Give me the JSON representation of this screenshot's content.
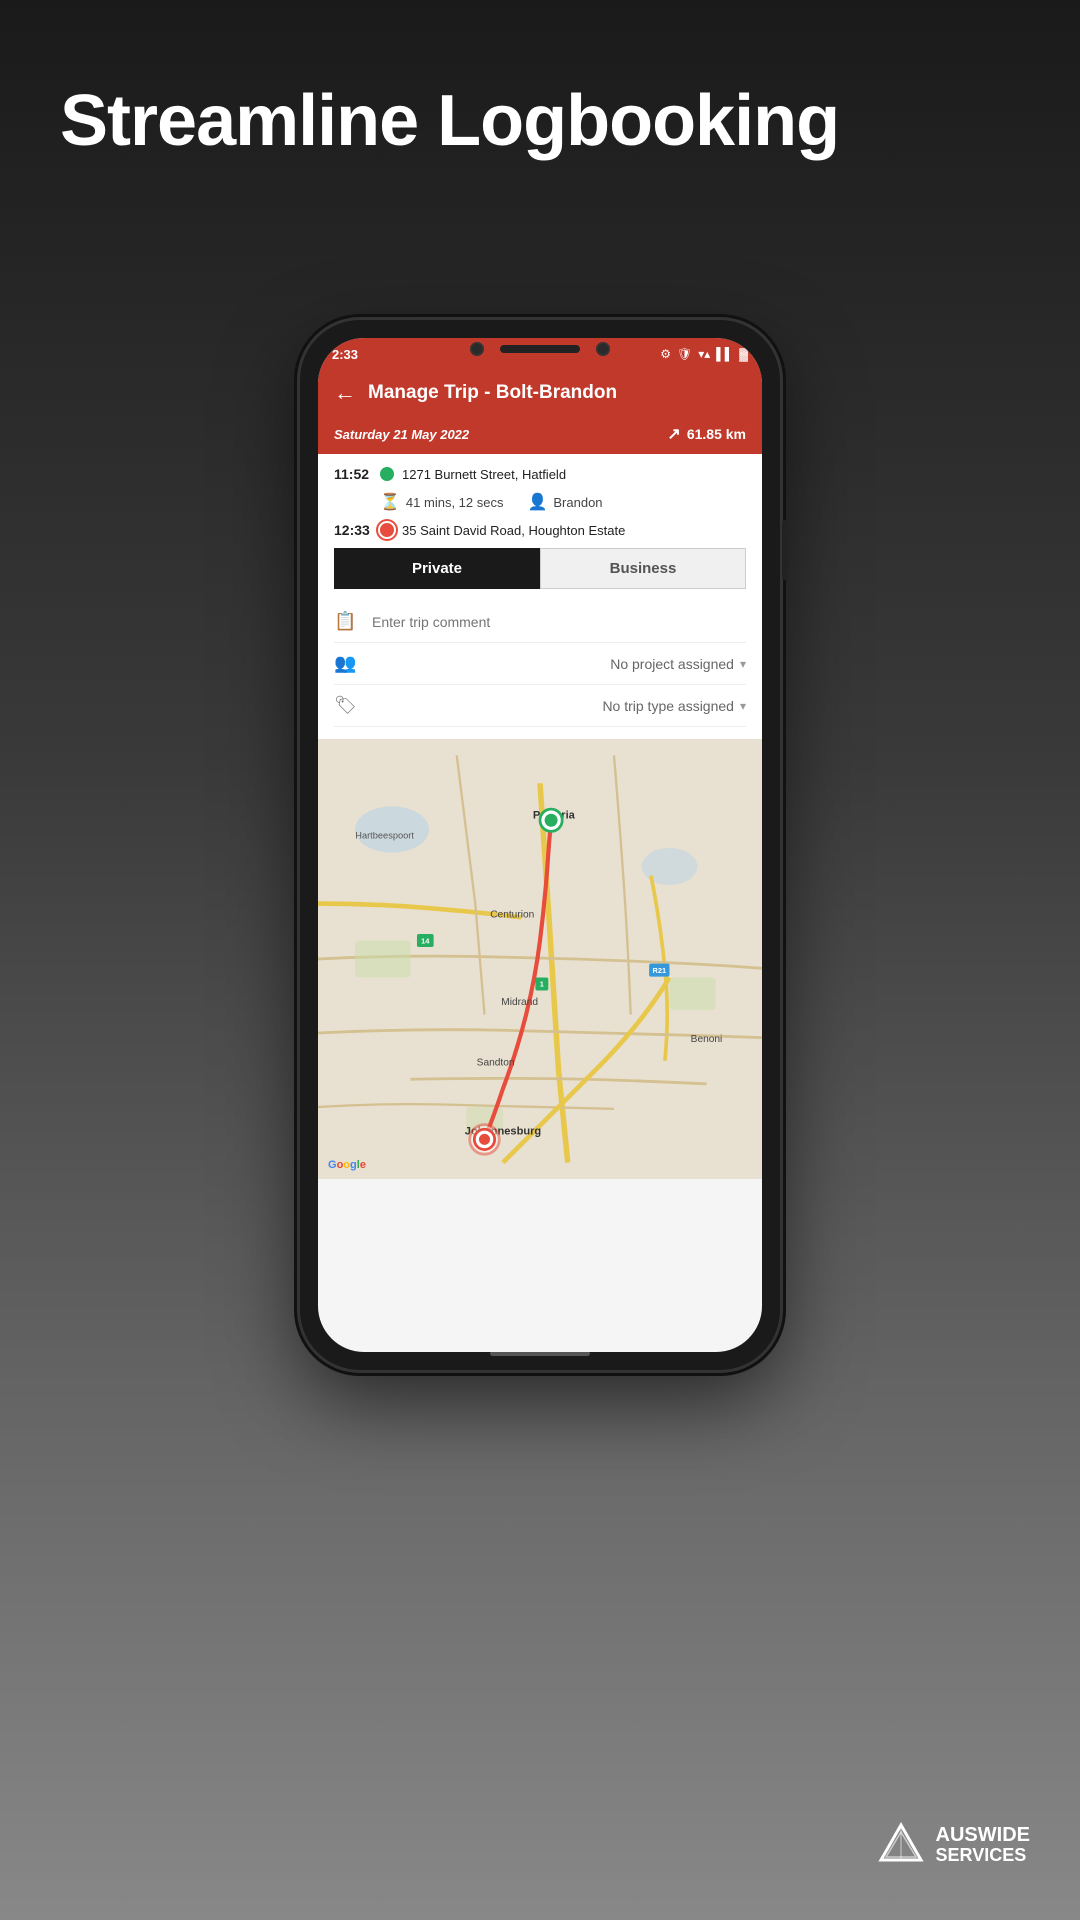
{
  "page": {
    "title": "Streamline Logbooking",
    "background": "#1a1a1a"
  },
  "status_bar": {
    "time": "2:33",
    "signal": "wifi",
    "battery": "full"
  },
  "header": {
    "title": "Manage Trip - Bolt-Brandon",
    "back_label": "←"
  },
  "trip": {
    "date": "Saturday 21 May 2022",
    "distance": "61.85 km",
    "start_time": "11:52",
    "start_address": "1271 Burnett Street, Hatfield",
    "duration": "41 mins, 12 secs",
    "driver": "Brandon",
    "end_time": "12:33",
    "end_address": "35 Saint David Road, Houghton Estate"
  },
  "toggle": {
    "private_label": "Private",
    "business_label": "Business",
    "active": "private"
  },
  "form": {
    "comment_placeholder": "Enter trip comment",
    "project_label": "No project assigned",
    "trip_type_label": "No trip type assigned"
  },
  "map": {
    "city_labels": [
      "Pretoria",
      "Centurion",
      "Midrand",
      "Sandton",
      "Johannesburg",
      "Hartbeespoort",
      "Benoni"
    ],
    "road_labels": [
      "14",
      "1",
      "R21"
    ]
  },
  "branding": {
    "company": "AUSWIDE",
    "tagline": "SERVICES"
  }
}
